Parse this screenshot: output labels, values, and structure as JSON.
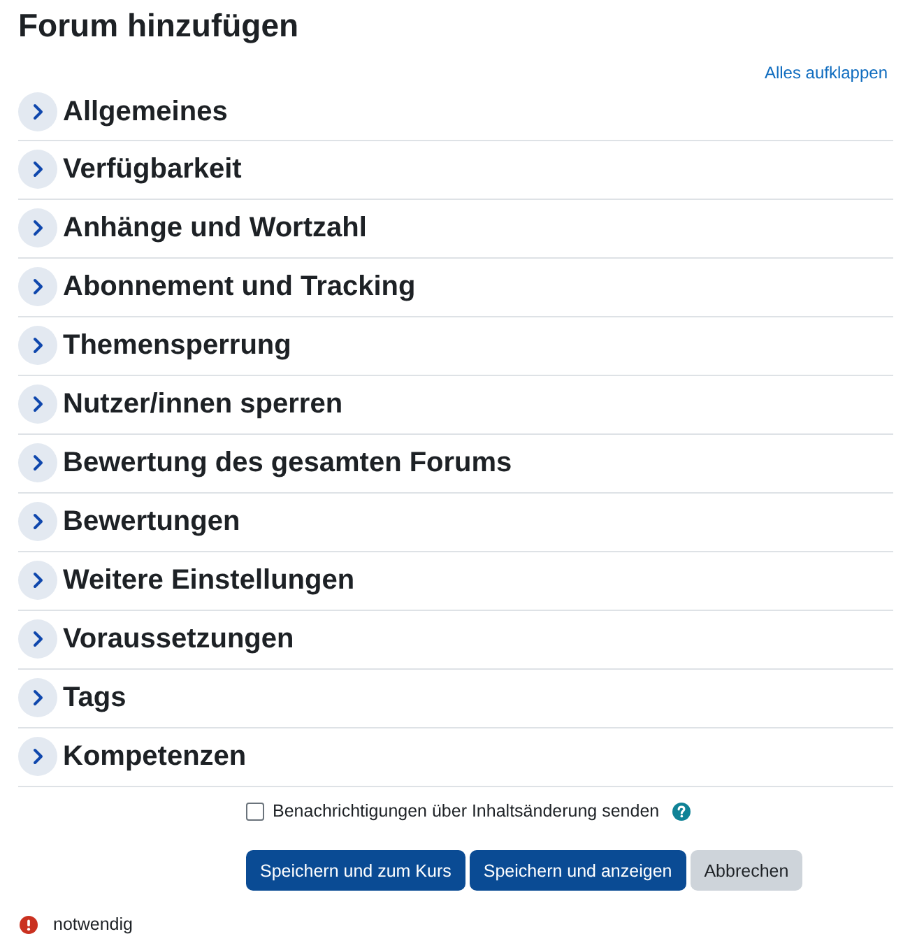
{
  "page": {
    "title": "Forum hinzufügen"
  },
  "expand_all_link": "Alles aufklappen",
  "sections": [
    {
      "title": "Allgemeines",
      "expanded": false
    },
    {
      "title": "Verfügbarkeit",
      "expanded": false
    },
    {
      "title": "Anhänge und Wortzahl",
      "expanded": false
    },
    {
      "title": "Abonnement und Tracking",
      "expanded": false
    },
    {
      "title": "Themensperrung",
      "expanded": false
    },
    {
      "title": "Nutzer/innen sperren",
      "expanded": false
    },
    {
      "title": "Bewertung des gesamten Forums",
      "expanded": false
    },
    {
      "title": "Bewertungen",
      "expanded": false
    },
    {
      "title": "Weitere Einstellungen",
      "expanded": false
    },
    {
      "title": "Voraussetzungen",
      "expanded": false
    },
    {
      "title": "Tags",
      "expanded": false
    },
    {
      "title": "Kompetenzen",
      "expanded": false
    }
  ],
  "notify_checkbox": {
    "label": "Benachrichtigungen über Inhaltsänderung senden",
    "checked": false
  },
  "buttons": [
    {
      "label": "Speichern und zum Kurs",
      "kind": "primary"
    },
    {
      "label": "Speichern und anzeigen",
      "kind": "primary"
    },
    {
      "label": "Abbrechen",
      "kind": "secondary"
    }
  ],
  "required_note": "notwendig"
}
